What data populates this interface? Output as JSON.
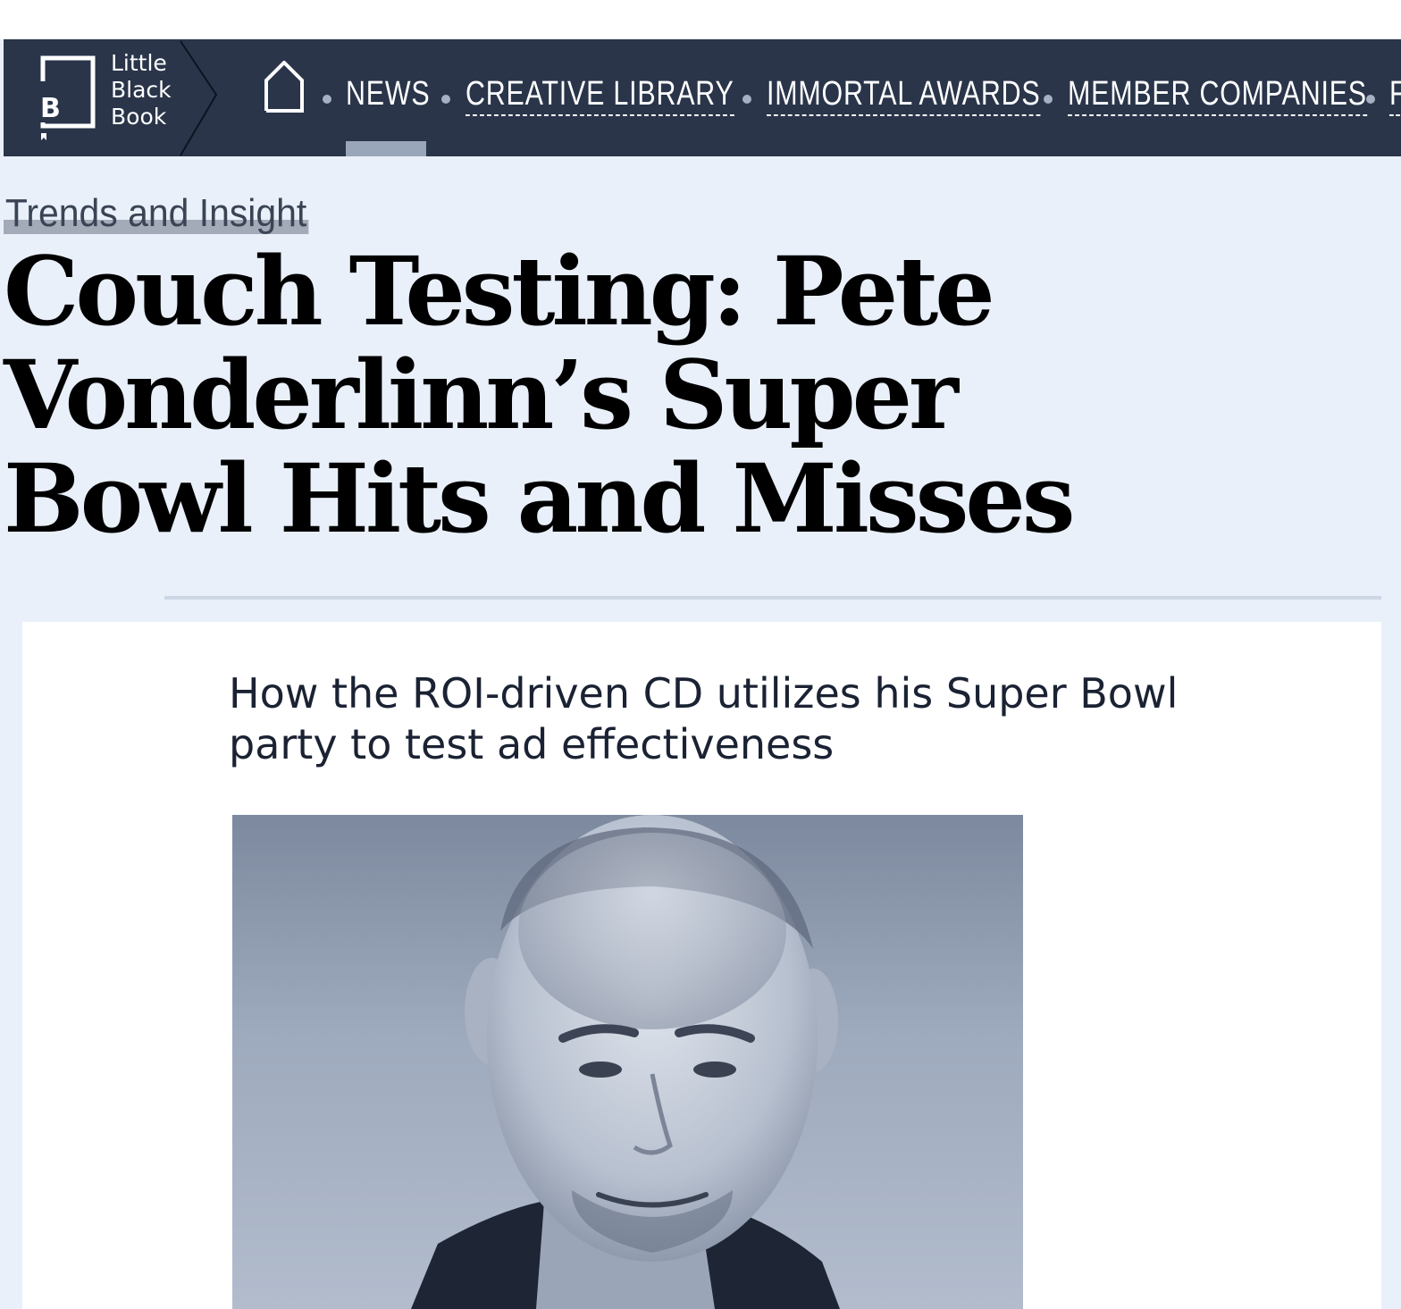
{
  "logo": {
    "line1": "Little",
    "line2": "Black",
    "line3": "Book",
    "mark": "B"
  },
  "nav": {
    "home_icon": "home-icon",
    "items": [
      {
        "label": "NEWS",
        "active": true
      },
      {
        "label": "CREATIVE LIBRARY"
      },
      {
        "label": "IMMORTAL AWARDS"
      },
      {
        "label": "MEMBER COMPANIES"
      },
      {
        "label": "F"
      }
    ]
  },
  "article": {
    "category": "Trends and Insight",
    "headline_line1": "Couch Testing: Pete",
    "headline_line2": "Vonderlinn’s Super",
    "headline_line3": "Bowl Hits and Misses",
    "subheadline": "How the ROI-driven CD utilizes his Super Bowl party to test ad effectiveness"
  },
  "colors": {
    "nav_bg": "#2a354a",
    "page_bg": "#e9f0fa",
    "active_indicator": "#99a5b9"
  }
}
